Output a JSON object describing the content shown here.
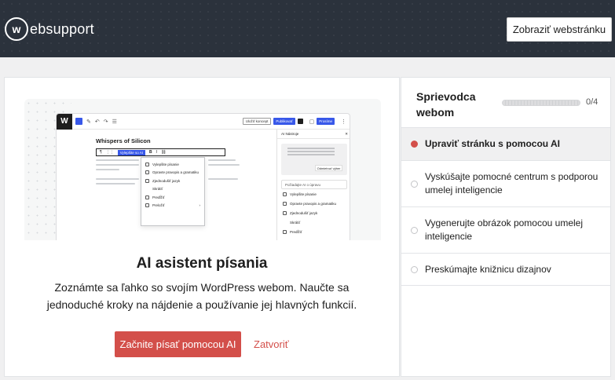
{
  "header": {
    "logo_mark": "w",
    "logo_text": "ebsupport",
    "view_site_button": "Zobraziť webstránku"
  },
  "preview": {
    "post_title": "Whispers of Silicon",
    "toolbar_chip": "Uložiť koncept",
    "toolbar_preview": "Publikovať",
    "toolbar_publish": "Prosíme",
    "block_toolbar_ai": "Vylepšite so AI",
    "popup_items": [
      "Vylepšite písanie",
      "Opravte pravopis a gramatiku",
      "Zjednodušiť jazyk",
      "Skrátiť",
      "Predĺžiť",
      "Preložiť"
    ],
    "side_panel_title": "AI Nástroje",
    "side_panel_button": "Odmietnuť výber",
    "side_panel_input": "Požiadajte AI o úpravu",
    "side_panel_items": [
      "Vylepšite písanie",
      "Opravte pravopis a gramatiku",
      "Zjednodušiť jazyk",
      "Skrátiť",
      "Predĺžiť"
    ]
  },
  "card": {
    "title": "AI asistent písania",
    "description": "Zoznámte sa ľahko so svojím WordPress webom. Naučte sa jednoduché kroky na nájdenie a používanie jej hlavných funkcií.",
    "primary_button": "Začnite písať pomocou AI",
    "close_link": "Zatvoriť"
  },
  "guide": {
    "title": "Sprievodca webom",
    "progress_text": "0/4",
    "progress_value": 0,
    "steps": [
      {
        "label": "Upraviť stránku s pomocou AI",
        "active": true
      },
      {
        "label": "Vyskúšajte pomocné centrum s podporou umelej inteligencie",
        "active": false
      },
      {
        "label": "Vygenerujte obrázok pomocou umelej inteligencie",
        "active": false
      },
      {
        "label": "Preskúmajte knižnicu dizajnov",
        "active": false
      }
    ]
  },
  "colors": {
    "header_bg": "#2b323c",
    "accent_red": "#d34f4a",
    "wp_blue": "#3858e9"
  }
}
